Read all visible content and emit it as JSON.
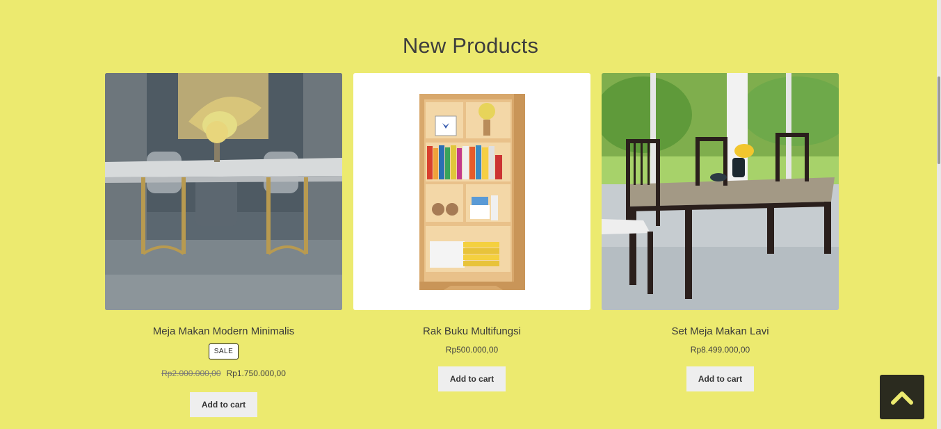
{
  "section": {
    "title": "New Products"
  },
  "products": [
    {
      "name": "Meja Makan Modern Minimalis",
      "badge": "SALE",
      "old_price": "Rp2.000.000,00",
      "price": "Rp1.750.000,00",
      "button": "Add to cart",
      "image": "dining-table-marble-photo"
    },
    {
      "name": "Rak Buku Multifungsi",
      "price": "Rp500.000,00",
      "button": "Add to cart",
      "image": "bookshelf-photo"
    },
    {
      "name": "Set Meja Makan Lavi",
      "price": "Rp8.499.000,00",
      "button": "Add to cart",
      "image": "dining-set-garden-photo"
    }
  ],
  "back_to_top": {
    "icon": "chevron-up-icon"
  },
  "colors": {
    "background": "#ecea6f",
    "button": "#eeeeee",
    "back_to_top": "#2b2b1f"
  }
}
